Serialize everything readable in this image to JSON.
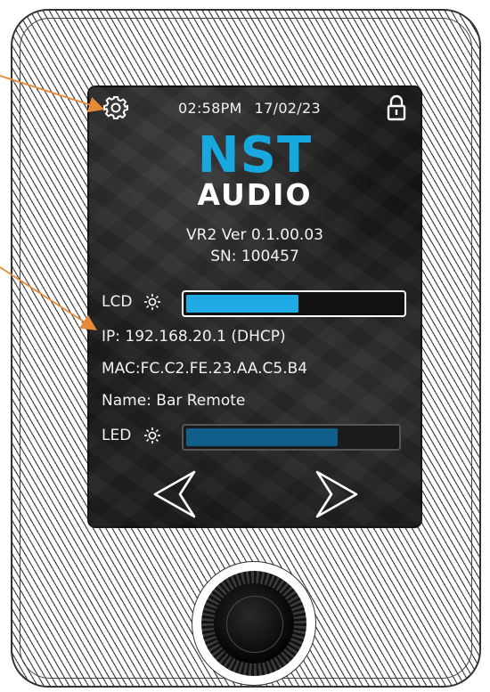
{
  "status_bar": {
    "time": "02:58PM",
    "date": "17/02/23",
    "settings_icon": "gear-icon",
    "lock_icon": "lock-icon"
  },
  "logo": {
    "brand": "NST",
    "sub": "AUDIO",
    "brand_color": "#18a8e0"
  },
  "device_info": {
    "version": "VR2 Ver 0.1.00.03",
    "serial": "SN: 100457",
    "ip": "IP:  192.168.20.1 (DHCP)",
    "mac": "MAC:FC.C2.FE.23.AA.C5.B4",
    "name": "Name:  Bar Remote"
  },
  "lcd_brightness": {
    "label": "LCD",
    "icon": "brightness-icon",
    "level": 0.52,
    "color": "#1faae6"
  },
  "led_brightness": {
    "label": "LED",
    "icon": "brightness-icon",
    "level": 0.72,
    "color": "#115e8a"
  },
  "navigation": {
    "prev_icon": "chevron-left-icon",
    "next_icon": "chevron-right-icon"
  },
  "hardware": {
    "knob": "rotary-knob",
    "callout_color": "#e8893a"
  }
}
